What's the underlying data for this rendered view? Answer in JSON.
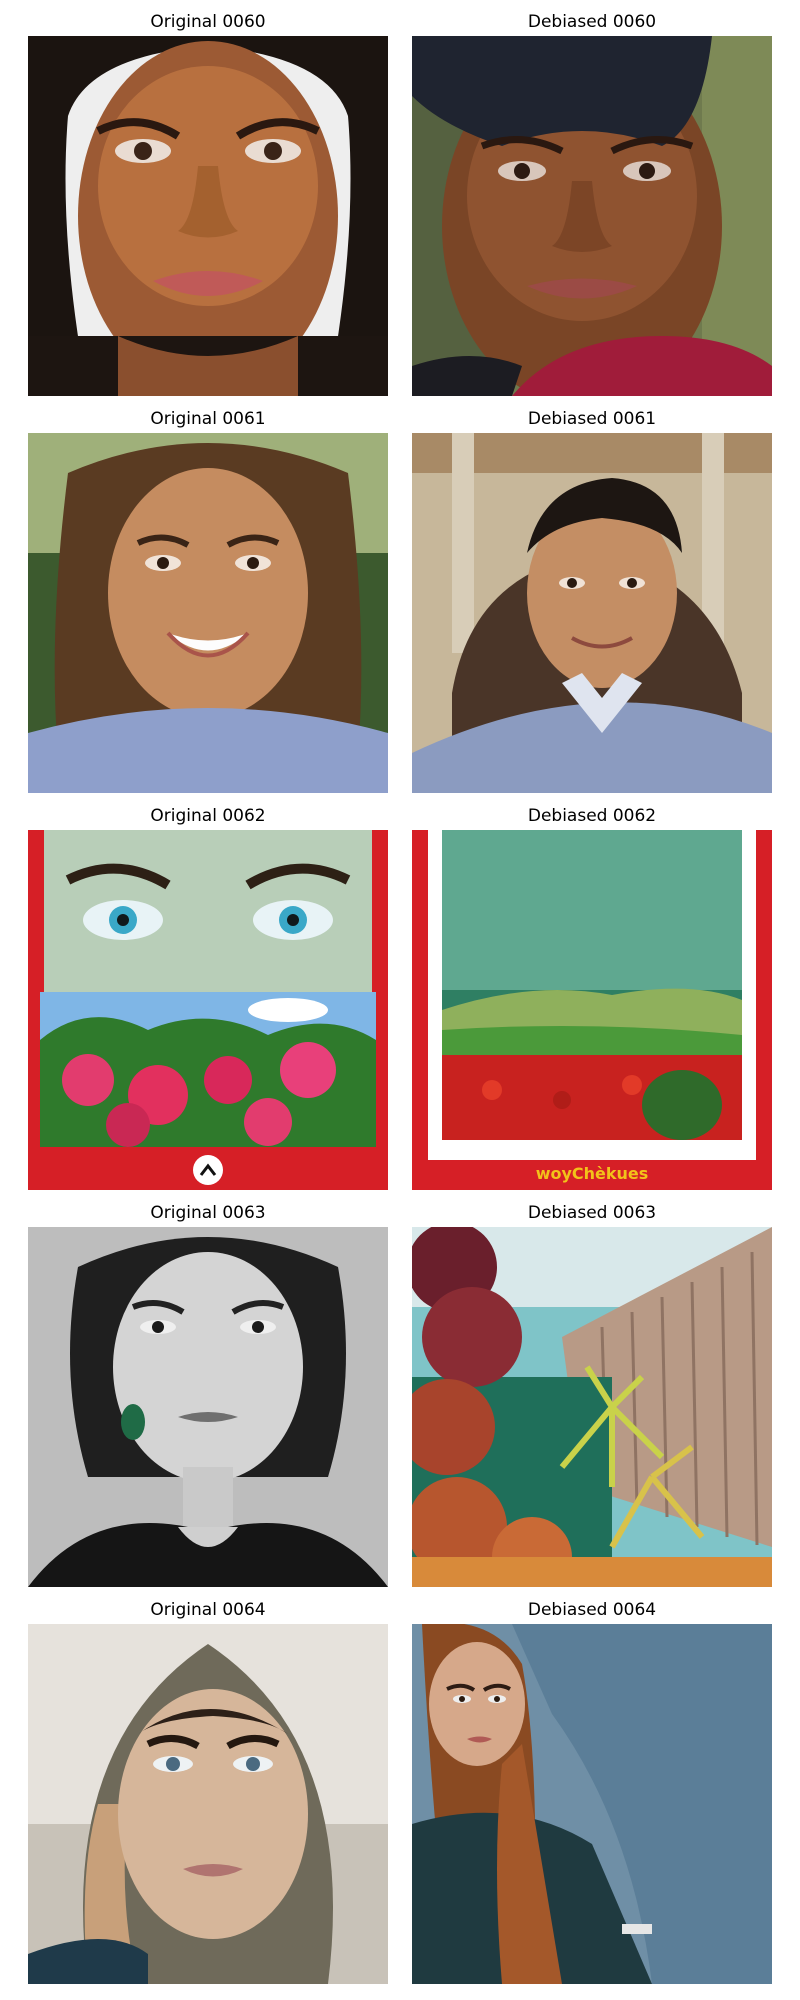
{
  "figure": {
    "rows": [
      {
        "original": {
          "title": "Original 0060"
        },
        "debiased": {
          "title": "Debiased 0060"
        }
      },
      {
        "original": {
          "title": "Original 0061"
        },
        "debiased": {
          "title": "Debiased 0061"
        }
      },
      {
        "original": {
          "title": "Original 0062"
        },
        "debiased": {
          "title": "Debiased 0062",
          "overlay_text": "woyChèkues"
        }
      },
      {
        "original": {
          "title": "Original 0063"
        },
        "debiased": {
          "title": "Debiased 0063"
        }
      },
      {
        "original": {
          "title": "Original 0064"
        },
        "debiased": {
          "title": "Debiased 0064"
        }
      }
    ]
  }
}
